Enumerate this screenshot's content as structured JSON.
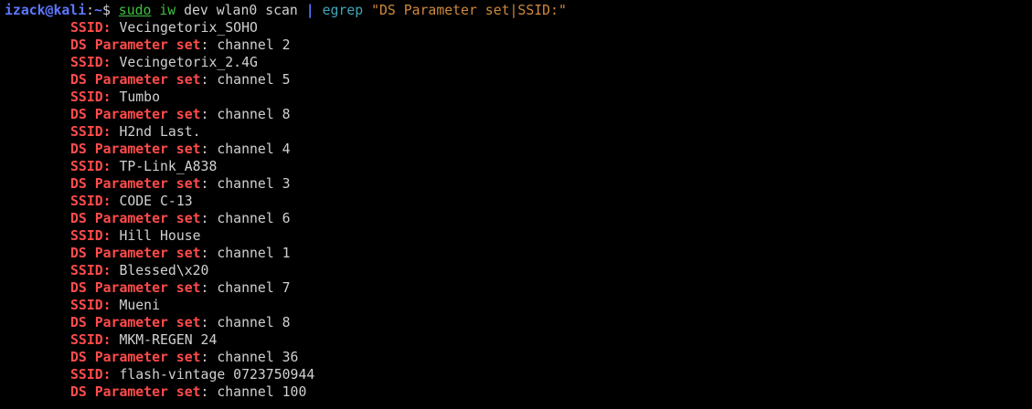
{
  "prompt": {
    "user": "izack",
    "at": "@",
    "host": "kali",
    "sep": ":",
    "path": "~",
    "symbol": "$"
  },
  "command": {
    "sudo": "sudo",
    "iw": "iw",
    "args": "dev wlan0 scan",
    "pipe": "|",
    "egrep": "egrep",
    "pattern": "\"DS Parameter set|SSID:\""
  },
  "output": [
    {
      "key": "SSID:",
      "value": " Vecingetorix_SOHO"
    },
    {
      "key": "DS Parameter set",
      "value": ": channel 2"
    },
    {
      "key": "SSID:",
      "value": " Vecingetorix_2.4G"
    },
    {
      "key": "DS Parameter set",
      "value": ": channel 5"
    },
    {
      "key": "SSID:",
      "value": " Tumbo"
    },
    {
      "key": "DS Parameter set",
      "value": ": channel 8"
    },
    {
      "key": "SSID:",
      "value": " H2nd Last."
    },
    {
      "key": "DS Parameter set",
      "value": ": channel 4"
    },
    {
      "key": "SSID:",
      "value": " TP-Link_A838"
    },
    {
      "key": "DS Parameter set",
      "value": ": channel 3"
    },
    {
      "key": "SSID:",
      "value": " CODE C-13"
    },
    {
      "key": "DS Parameter set",
      "value": ": channel 6"
    },
    {
      "key": "SSID:",
      "value": " Hill House"
    },
    {
      "key": "DS Parameter set",
      "value": ": channel 1"
    },
    {
      "key": "SSID:",
      "value": " Blessed\\x20"
    },
    {
      "key": "DS Parameter set",
      "value": ": channel 7"
    },
    {
      "key": "SSID:",
      "value": " Mueni"
    },
    {
      "key": "DS Parameter set",
      "value": ": channel 8"
    },
    {
      "key": "SSID:",
      "value": " MKM-REGEN 24"
    },
    {
      "key": "DS Parameter set",
      "value": ": channel 36"
    },
    {
      "key": "SSID:",
      "value": " flash-vintage 0723750944"
    },
    {
      "key": "DS Parameter set",
      "value": ": channel 100"
    }
  ],
  "colors": {
    "background": "#000000",
    "prompt": "#5c78ff",
    "match": "#ff4b4b",
    "command": "#3ec13e",
    "egrep": "#3fa7b8",
    "string": "#d08a3c",
    "text": "#d0d0d0"
  }
}
